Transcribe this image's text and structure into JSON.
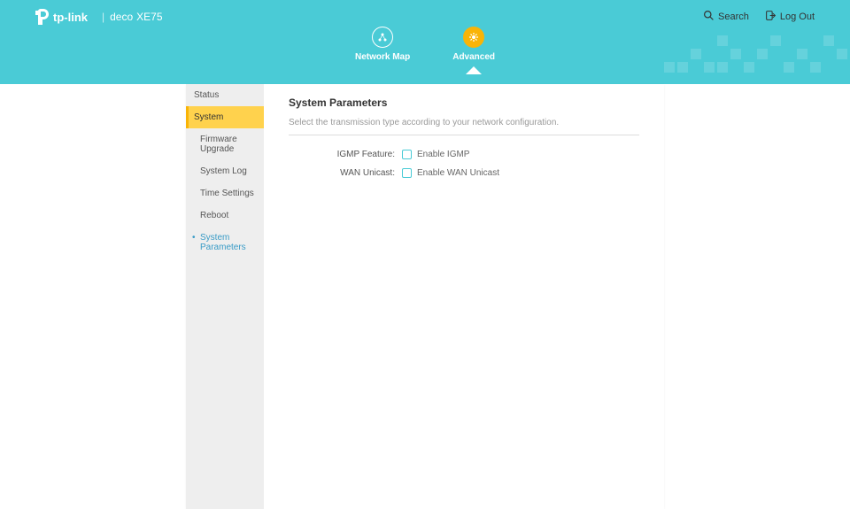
{
  "brand": "tp-link",
  "product": {
    "line": "deco",
    "model": "XE75"
  },
  "header": {
    "search": "Search",
    "logout": "Log Out"
  },
  "tabs": [
    {
      "id": "network-map",
      "label": "Network Map"
    },
    {
      "id": "advanced",
      "label": "Advanced"
    }
  ],
  "sidebar": {
    "status": "Status",
    "system": "System",
    "items": [
      {
        "label": "Firmware Upgrade"
      },
      {
        "label": "System Log"
      },
      {
        "label": "Time Settings"
      },
      {
        "label": "Reboot"
      },
      {
        "label": "System Parameters"
      }
    ]
  },
  "page": {
    "title": "System Parameters",
    "description": "Select the transmission type according to your network configuration.",
    "igmp": {
      "label": "IGMP Feature:",
      "option": "Enable IGMP",
      "checked": false
    },
    "wan": {
      "label": "WAN Unicast:",
      "option": "Enable WAN Unicast",
      "checked": false
    }
  }
}
